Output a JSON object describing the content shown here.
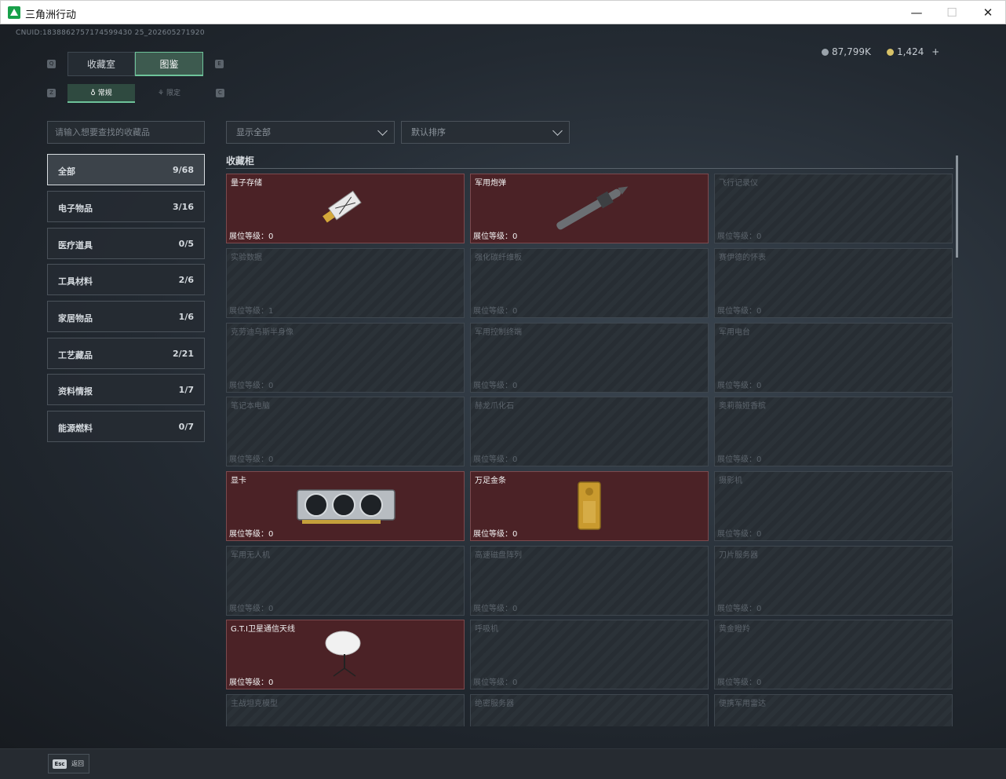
{
  "window": {
    "title": "三角洲行动",
    "minimize": "—",
    "maximize": "☐",
    "close": "✕"
  },
  "header": {
    "uid": "CNUID:1838862757174599430 25_202605271920",
    "currency1": "87,799K",
    "currency2": "1,424",
    "plus": "+",
    "key_q": "Q",
    "key_e": "E",
    "key_z": "Z",
    "key_c": "C"
  },
  "tabs": [
    {
      "label": "收藏室",
      "active": false
    },
    {
      "label": "图鉴",
      "active": true
    }
  ],
  "subtabs": [
    {
      "label": "常规",
      "active": true
    },
    {
      "label": "限定",
      "active": false
    }
  ],
  "search": {
    "placeholder": "请输入想要查找的收藏品"
  },
  "filters": {
    "show": "显示全部",
    "sort": "默认排序"
  },
  "categories": [
    {
      "label": "全部",
      "count": "9/68",
      "active": true
    },
    {
      "label": "电子物品",
      "count": "3/16"
    },
    {
      "label": "医疗道具",
      "count": "0/5"
    },
    {
      "label": "工具材料",
      "count": "2/6"
    },
    {
      "label": "家居物品",
      "count": "1/6"
    },
    {
      "label": "工艺藏品",
      "count": "2/21"
    },
    {
      "label": "资料情报",
      "count": "1/7"
    },
    {
      "label": "能源燃料",
      "count": "0/7"
    }
  ],
  "section": {
    "title": "收藏柜"
  },
  "items": [
    {
      "name": "量子存储",
      "level": "展位等级：0",
      "owned": true,
      "art": "usb-drive-icon"
    },
    {
      "name": "军用炮弹",
      "level": "展位等级：0",
      "owned": true,
      "art": "shell-icon"
    },
    {
      "name": "飞行记录仪",
      "level": "展位等级：0",
      "owned": false
    },
    {
      "name": "实验数据",
      "level": "展位等级：1",
      "owned": false
    },
    {
      "name": "强化碳纤维板",
      "level": "展位等级：0",
      "owned": false
    },
    {
      "name": "赛伊德的怀表",
      "level": "展位等级：0",
      "owned": false
    },
    {
      "name": "克劳迪乌斯半身像",
      "level": "展位等级：0",
      "owned": false
    },
    {
      "name": "军用控制终端",
      "level": "展位等级：0",
      "owned": false
    },
    {
      "name": "军用电台",
      "level": "展位等级：0",
      "owned": false
    },
    {
      "name": "笔记本电脑",
      "level": "展位等级：0",
      "owned": false
    },
    {
      "name": "赫龙爪化石",
      "level": "展位等级：0",
      "owned": false
    },
    {
      "name": "奥莉薇娅香槟",
      "level": "展位等级：0",
      "owned": false
    },
    {
      "name": "显卡",
      "level": "展位等级：0",
      "owned": true,
      "art": "gpu-icon"
    },
    {
      "name": "万足金条",
      "level": "展位等级：0",
      "owned": true,
      "art": "gold-bar-icon"
    },
    {
      "name": "摄影机",
      "level": "展位等级：0",
      "owned": false
    },
    {
      "name": "军用无人机",
      "level": "展位等级：0",
      "owned": false
    },
    {
      "name": "高速磁盘阵列",
      "level": "展位等级：0",
      "owned": false
    },
    {
      "name": "刀片服务器",
      "level": "展位等级：0",
      "owned": false
    },
    {
      "name": "G.T.I卫星通信天线",
      "level": "展位等级：0",
      "owned": true,
      "art": "satellite-dish-icon"
    },
    {
      "name": "呼吸机",
      "level": "展位等级：0",
      "owned": false
    },
    {
      "name": "黄金瞪羚",
      "level": "展位等级：0",
      "owned": false
    },
    {
      "name": "主战坦克模型",
      "level": "",
      "owned": false
    },
    {
      "name": "绝密服务器",
      "level": "",
      "owned": false
    },
    {
      "name": "便携军用雷达",
      "level": "",
      "owned": false
    }
  ],
  "footer": {
    "esc_key": "Esc",
    "esc_label": "返回"
  },
  "colors": {
    "accent": "#6ec39a",
    "owned_card": "#4b2226",
    "coin1": "#9aa3ab",
    "coin2": "#d8c267"
  }
}
